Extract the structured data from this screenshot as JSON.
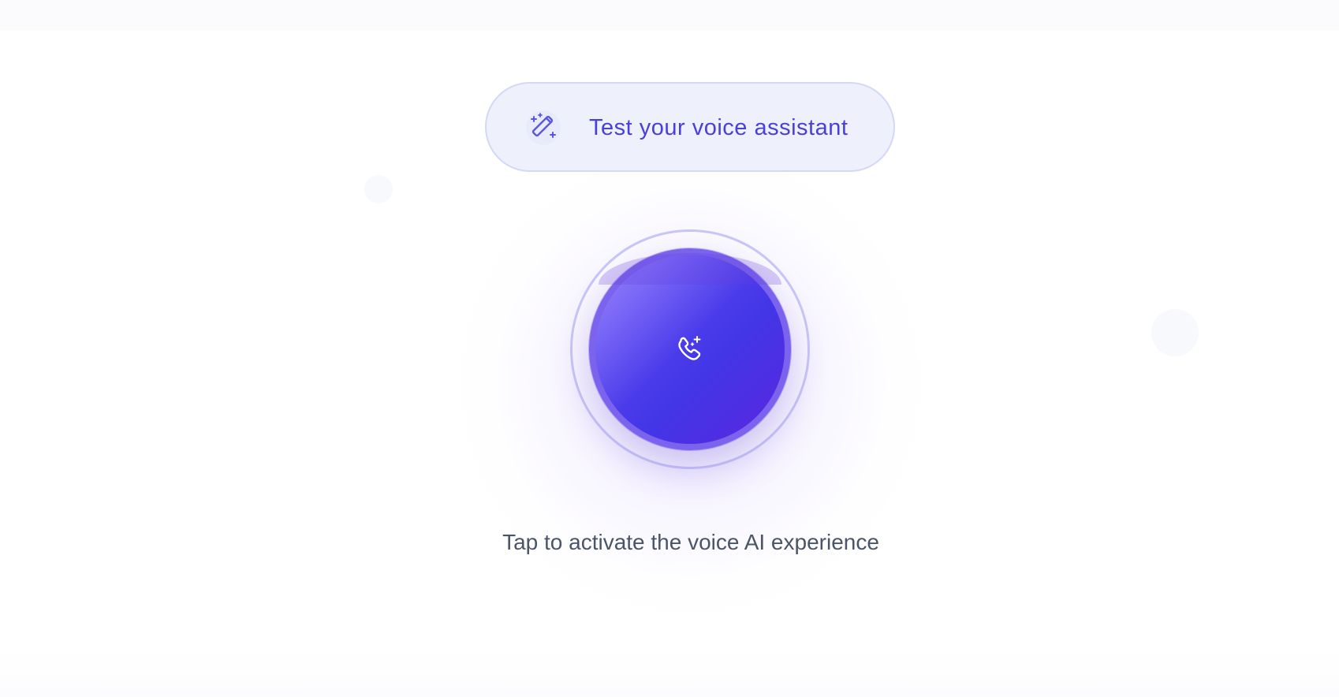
{
  "header": {
    "title": "Test your voice assistant",
    "icon": "magic-wand-sparkles-icon"
  },
  "call": {
    "icon": "phone-sparkle-icon",
    "caption": "Tap to activate the voice AI experience"
  },
  "colors": {
    "accent": "#4a3fd9",
    "pill_background": "#eef1fc",
    "pill_border": "#d3d8f5",
    "button_gradient_start": "#9a82f6",
    "button_gradient_mid": "#4236e6",
    "button_gradient_end": "#5b26df",
    "caption_text": "#4a5568"
  }
}
